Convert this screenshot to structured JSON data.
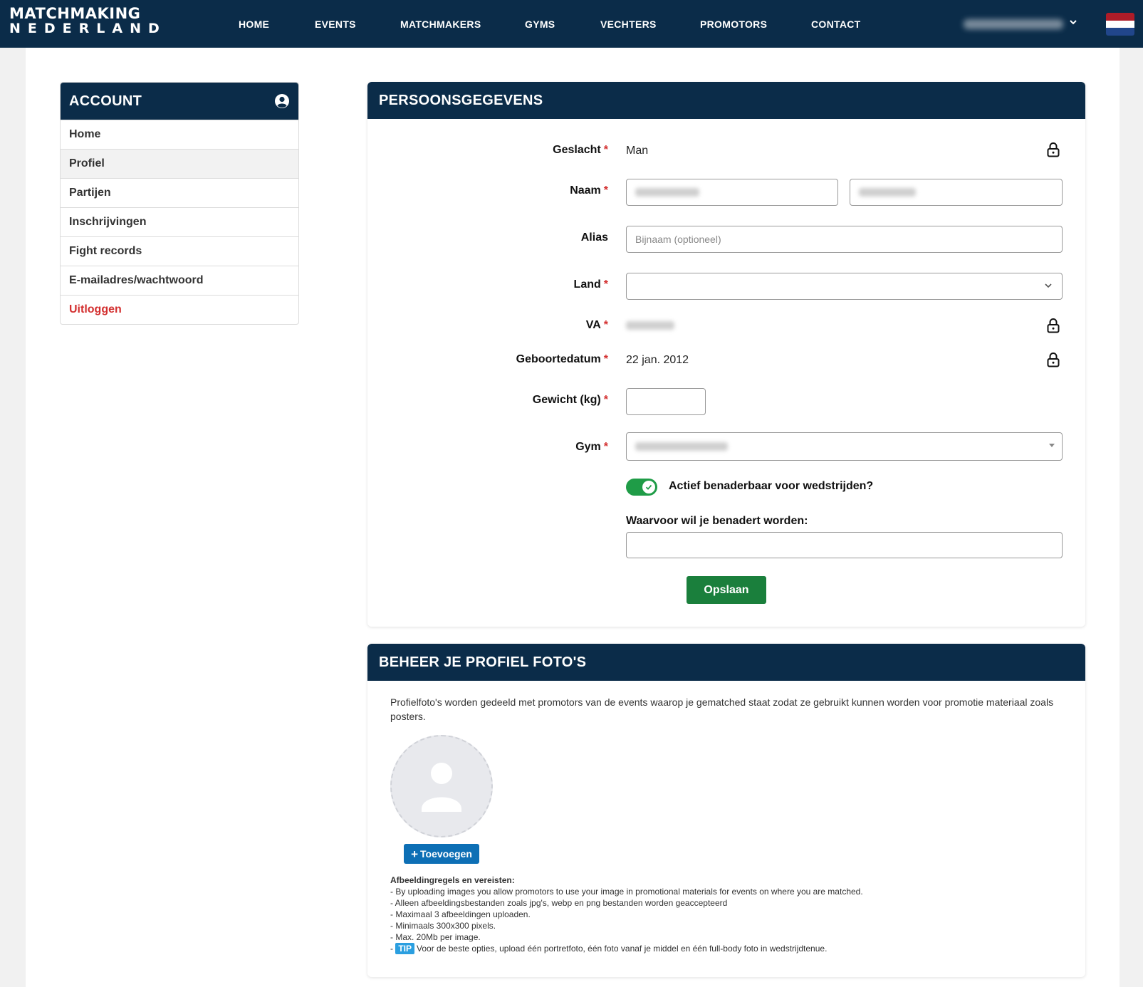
{
  "brand": {
    "line1": "MATCHMAKING",
    "line2": "NEDERLAND"
  },
  "nav": {
    "items": [
      "HOME",
      "EVENTS",
      "MATCHMAKERS",
      "GYMS",
      "VECHTERS",
      "PROMOTORS",
      "CONTACT"
    ],
    "user_menu_icon": "chevron-down-icon",
    "flag": {
      "colors": [
        "#ae1c28",
        "#ffffff",
        "#21468b"
      ]
    }
  },
  "sidebar": {
    "title": "ACCOUNT",
    "items": [
      {
        "label": "Home"
      },
      {
        "label": "Profiel"
      },
      {
        "label": "Partijen"
      },
      {
        "label": "Inschrijvingen"
      },
      {
        "label": "Fight records"
      },
      {
        "label": "E-mailadres/wachtwoord"
      },
      {
        "label": "Uitloggen"
      }
    ]
  },
  "personal": {
    "title": "PERSOONSGEGEVENS",
    "gender": {
      "label": "Geslacht",
      "value": "Man"
    },
    "name": {
      "label": "Naam"
    },
    "alias": {
      "label": "Alias",
      "placeholder": "Bijnaam (optioneel)"
    },
    "country": {
      "label": "Land"
    },
    "va": {
      "label": "VA"
    },
    "birthdate": {
      "label": "Geboortedatum",
      "value": "22 jan. 2012"
    },
    "weight": {
      "label": "Gewicht (kg)"
    },
    "gym": {
      "label": "Gym"
    },
    "active": {
      "label": "Actief benaderbaar voor wedstrijden?",
      "checked": true
    },
    "purpose": {
      "label": "Waarvoor wil je benadert worden:"
    },
    "save_label": "Opslaan",
    "required_mark": "*"
  },
  "photos": {
    "title": "BEHEER JE PROFIEL FOTO'S",
    "description": "Profielfoto's worden gedeeld met promotors van de events waarop je gematched staat zodat ze gebruikt kunnen worden voor promotie materiaal zoals posters.",
    "add_label": "Toevoegen",
    "add_icon": "+",
    "rules_title": "Afbeeldingregels en vereisten:",
    "rules": [
      "- By uploading images you allow promotors to use your image in promotional materials for events on where you are matched.",
      "- Alleen afbeeldingsbestanden zoals jpg's, webp en png bestanden worden geaccepteerd",
      "- Maximaal 3 afbeeldingen uploaden.",
      "- Minimaals 300x300 pixels.",
      "- Max. 20Mb per image."
    ],
    "tip_prefix": "-",
    "tip_badge": "TIP",
    "tip_text": "Voor de beste opties, upload één portretfoto, één foto vanaf je middel en één full-body foto in wedstrijdtenue."
  },
  "colors": {
    "navy": "#0b2c49",
    "green": "#1a7f3c",
    "blue": "#0d6fb5",
    "red": "#d32f2f"
  }
}
